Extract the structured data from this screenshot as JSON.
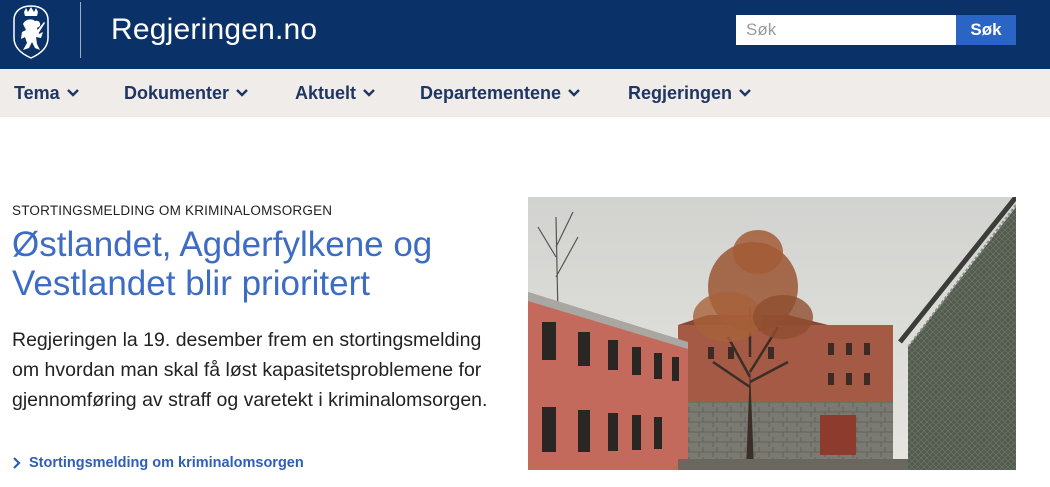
{
  "header": {
    "site_title": "Regjeringen.no",
    "search_placeholder": "Søk",
    "search_button": "Søk",
    "logo_icon": "coat-of-arms-lion-icon"
  },
  "nav": {
    "items": [
      {
        "label": "Tema"
      },
      {
        "label": "Dokumenter"
      },
      {
        "label": "Aktuelt"
      },
      {
        "label": "Departementene"
      },
      {
        "label": "Regjeringen"
      }
    ]
  },
  "article": {
    "kicker": "STORTINGSMELDING OM KRIMINALOMSORGEN",
    "headline": "Østlandet, Agderfylkene og Vestlandet blir prioritert",
    "lead": "Regjeringen la 19. desember frem en stortingsmelding om hvordan man skal få løst kapasitetsproblemene for gjennomføring av straff og varetekt i kriminalomsorgen.",
    "link": "Stortingsmelding om kriminalomsorgen"
  },
  "colors": {
    "header_bg": "#0b3268",
    "nav_bg": "#efecea",
    "nav_text": "#1f3562",
    "headline": "#3c6cc4",
    "accent_button": "#2a64c5"
  }
}
